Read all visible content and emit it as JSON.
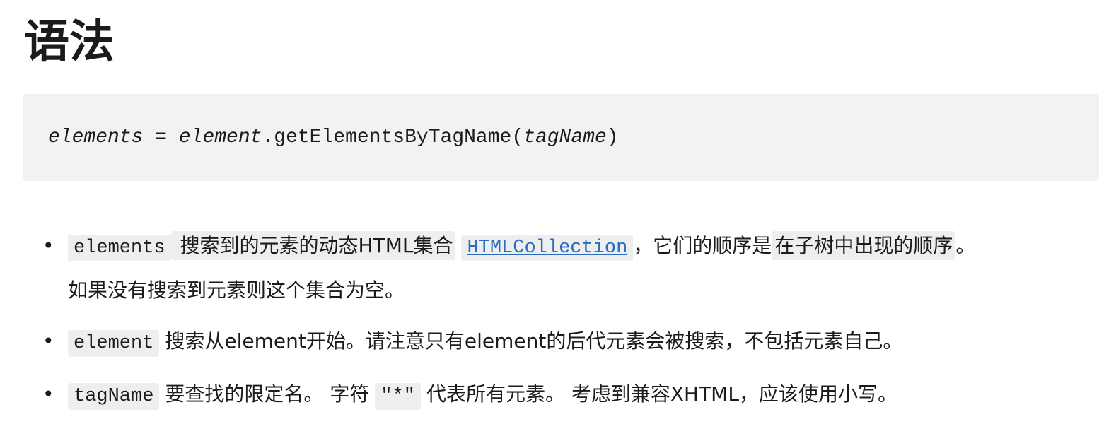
{
  "heading": "语法",
  "syntax": {
    "result": "elements",
    "equals": " = ",
    "object": "element",
    "method": ".getElementsByTagName(",
    "arg": "tagName",
    "close": ")"
  },
  "params": [
    {
      "code": "elements",
      "text_a": "搜索到的元素的动态HTML集合",
      "link": "HTMLCollection",
      "text_b": "，它们的顺序是",
      "chip": "在子树中出现的顺序",
      "text_c": "。",
      "line2": "如果没有搜索到元素则这个集合为空。"
    },
    {
      "code": "element",
      "text": "搜索从element开始。请注意只有element的后代元素会被搜索，不包括元素自己。"
    },
    {
      "code": "tagName",
      "text_a": "要查找的限定名。 字符",
      "code2": "\"*\"",
      "text_b": "代表所有元素。 考虑到兼容XHTML，应该使用小写。"
    }
  ]
}
